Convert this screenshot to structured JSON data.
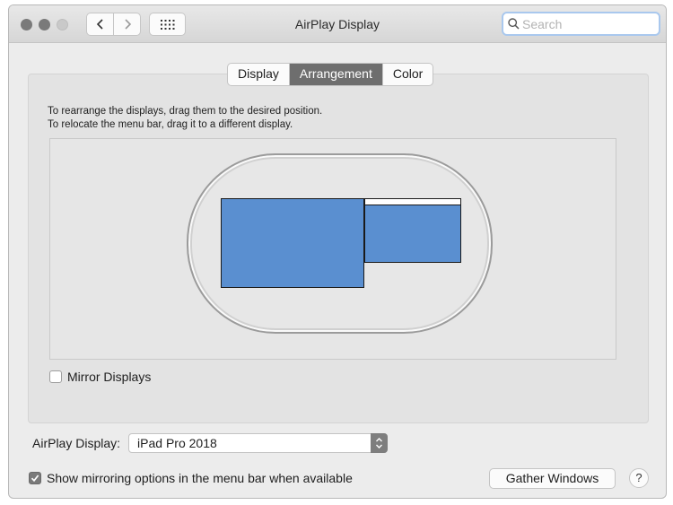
{
  "window": {
    "title": "AirPlay Display"
  },
  "toolbar": {
    "search_placeholder": "Search"
  },
  "tabs": [
    {
      "label": "Display",
      "active": false
    },
    {
      "label": "Arrangement",
      "active": true
    },
    {
      "label": "Color",
      "active": false
    }
  ],
  "arrangement": {
    "instruction_line1": "To rearrange the displays, drag them to the desired position.",
    "instruction_line2": "To relocate the menu bar, drag it to a different display."
  },
  "mirror": {
    "label": "Mirror Displays",
    "checked": false
  },
  "airplay": {
    "label": "AirPlay Display:",
    "selected": "iPad Pro 2018"
  },
  "show_mirroring": {
    "label": "Show mirroring options in the menu bar when available",
    "checked": true
  },
  "buttons": {
    "gather": "Gather Windows",
    "help": "?"
  },
  "icons": {
    "search": "magnifier-icon",
    "back": "chevron-left-icon",
    "forward": "chevron-right-icon",
    "grid": "grid-icon"
  },
  "colors": {
    "display_fill": "#5a8fd0",
    "active_tab": "#6e6e6e",
    "search_focus": "#a9c8ee"
  }
}
